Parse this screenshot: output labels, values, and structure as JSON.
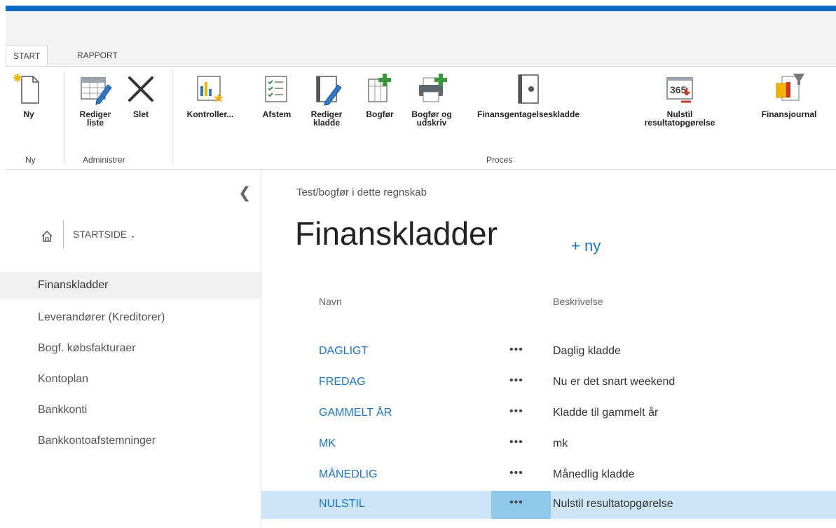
{
  "ribbon": {
    "tabs": [
      "START",
      "RAPPORT"
    ],
    "groups": {
      "ny": {
        "label": "Ny",
        "buttons": [
          {
            "label": "Ny",
            "icon": "new-document-icon"
          }
        ]
      },
      "administrer": {
        "label": "Administrer",
        "buttons": [
          {
            "label_lines": [
              "Rediger",
              "liste"
            ],
            "icon": "edit-list-icon"
          },
          {
            "label": "Slet",
            "icon": "delete-x-icon"
          }
        ]
      },
      "proces": {
        "label": "Proces",
        "buttons": [
          {
            "label": "Kontroller...",
            "icon": "check-report-icon"
          },
          {
            "label": "Afstem",
            "icon": "reconcile-list-icon"
          },
          {
            "label_lines": [
              "Rediger",
              "kladde"
            ],
            "icon": "edit-journal-icon"
          },
          {
            "label": "Bogfør",
            "icon": "post-icon"
          },
          {
            "label_lines": [
              "Bogfør og",
              "udskriv"
            ],
            "icon": "post-print-icon"
          },
          {
            "label": "Finansgentagelseskladde",
            "icon": "recurring-journal-icon"
          },
          {
            "label_lines": [
              "Nulstil",
              "resultatopgørelse"
            ],
            "icon": "reset-calendar-icon"
          },
          {
            "label": "Finansjournal",
            "icon": "gl-register-icon"
          }
        ]
      }
    }
  },
  "sidebar": {
    "startside": "STARTSIDE",
    "items": [
      {
        "label": "Finanskladder",
        "selected": true
      },
      {
        "label": "Leverandører (Kreditorer)",
        "selected": false
      },
      {
        "label": "Bogf. købsfakturaer",
        "selected": false
      },
      {
        "label": "Kontoplan",
        "selected": false
      },
      {
        "label": "Bankkonti",
        "selected": false
      },
      {
        "label": "Bankkontoafstemninger",
        "selected": false
      }
    ]
  },
  "main": {
    "subtitle": "Test/bogfør i dette regnskab",
    "title": "Finanskladder",
    "new_link": "+ ny",
    "columns": [
      "Navn",
      "Beskrivelse"
    ],
    "rows": [
      {
        "name": "DAGLIGT",
        "menu": "•••",
        "description": "Daglig kladde",
        "selected": false
      },
      {
        "name": "FREDAG",
        "menu": "•••",
        "description": "Nu er det snart weekend",
        "selected": false
      },
      {
        "name": "GAMMELT ÅR",
        "menu": "•••",
        "description": "Kladde til gammelt år",
        "selected": false
      },
      {
        "name": "MK",
        "menu": "•••",
        "description": "mk",
        "selected": false
      },
      {
        "name": "MÅNEDLIG",
        "menu": "•••",
        "description": "Månedlig kladde",
        "selected": false
      },
      {
        "name": "NULSTIL",
        "menu": "•••",
        "description": "Nulstil resultatopgørelse",
        "selected": true
      }
    ]
  },
  "colors": {
    "accent": "#0b6ac2",
    "link": "#1a73c9",
    "selected_row": "#cde6f7",
    "selected_menu": "#8fc6ec"
  }
}
